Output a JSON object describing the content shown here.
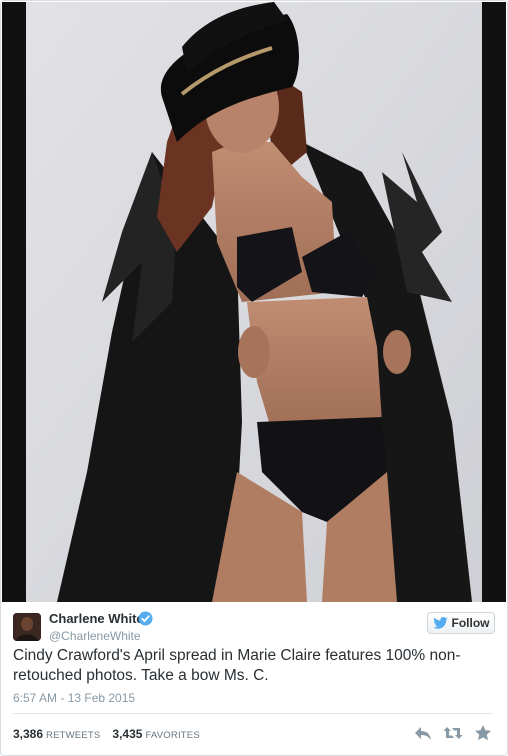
{
  "tweet": {
    "author": {
      "name": "Charlene White",
      "handle": "@CharleneWhite",
      "verified": true
    },
    "follow_label": "Follow",
    "text": "Cindy Crawford's April spread in Marie Claire features 100% non-retouched photos. Take a bow Ms. C.",
    "timestamp": "6:57 AM - 13 Feb 2015",
    "stats": {
      "retweets_count": "3,386",
      "retweets_label": "RETWEETS",
      "favorites_count": "3,435",
      "favorites_label": "FAVORITES"
    },
    "actions": [
      "reply-icon",
      "retweet-icon",
      "favorite-icon"
    ]
  },
  "colors": {
    "twitter_blue": "#55acee",
    "text_primary": "#292f33",
    "text_secondary": "#8899a6",
    "icon_gray": "#8899a6",
    "border": "#e1e8ed"
  }
}
